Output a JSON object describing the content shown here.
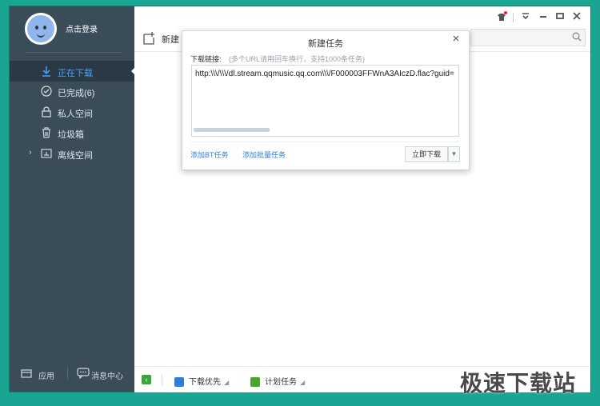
{
  "user": {
    "login_label": "点击登录"
  },
  "sidebar": {
    "items": [
      {
        "label": "正在下载",
        "icon": "download-icon",
        "active": true
      },
      {
        "label": "已完成(6)",
        "icon": "check-circle-icon",
        "active": false
      },
      {
        "label": "私人空间",
        "icon": "lock-icon",
        "active": false
      },
      {
        "label": "垃圾箱",
        "icon": "trash-icon",
        "active": false
      },
      {
        "label": "离线空间",
        "icon": "cloud-box-icon",
        "active": false
      }
    ],
    "bottom": {
      "apps_label": "应用",
      "messages_label": "消息中心"
    }
  },
  "toolbar": {
    "new_label": "新建"
  },
  "dialog": {
    "title": "新建任务",
    "link_label": "下载链接:",
    "hint": "(多个URL请用回车换行，支持1000条任务)",
    "url_value": "http:\\\\\\/\\\\\\/dl.stream.qqmusic.qq.com\\\\\\/F000003FFWnA3AIczD.flac?guid=",
    "add_bt": "添加BT任务",
    "add_batch": "添加批量任务",
    "download_now": "立即下载"
  },
  "bottombar": {
    "priority_label": "下载优先",
    "schedule_label": "计划任务"
  },
  "watermark": "极速下载站",
  "colors": {
    "accent": "#4aa3ff",
    "sidebar": "#3b4c59",
    "frame": "#1aa592",
    "link": "#2a7fd9"
  }
}
